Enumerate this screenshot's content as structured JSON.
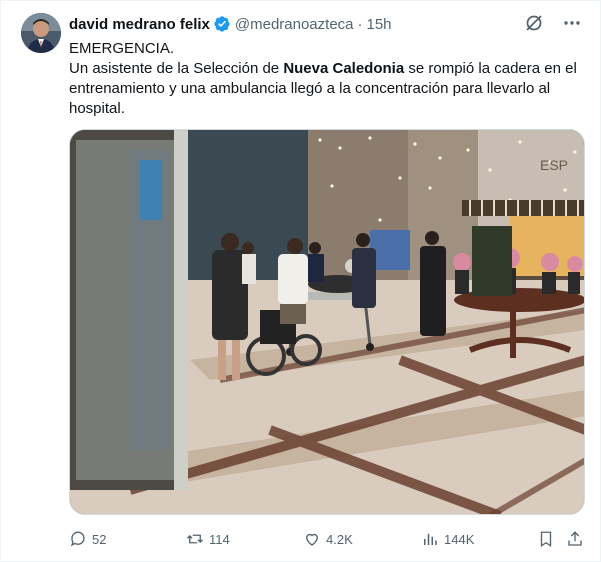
{
  "tweet": {
    "author": {
      "name": "david medrano felix",
      "handle": "@medranoazteca",
      "separator": "·",
      "time": "15h"
    },
    "text": {
      "line1": "EMERGENCIA.",
      "part1": "Un asistente de la Selección de ",
      "bold": "Nueva Caledonia",
      "part2": " se rompió la cadera en el entrenamiento y una ambulancia llegó a la concentración para llevarlo al hospital."
    },
    "media": {
      "sign_text": "ESP"
    },
    "actions": {
      "replies": "52",
      "reposts": "114",
      "likes": "4.2K",
      "views": "144K"
    },
    "colors": {
      "verified": "#1d9bf0",
      "text": "#0f1419",
      "muted": "#536471"
    }
  }
}
